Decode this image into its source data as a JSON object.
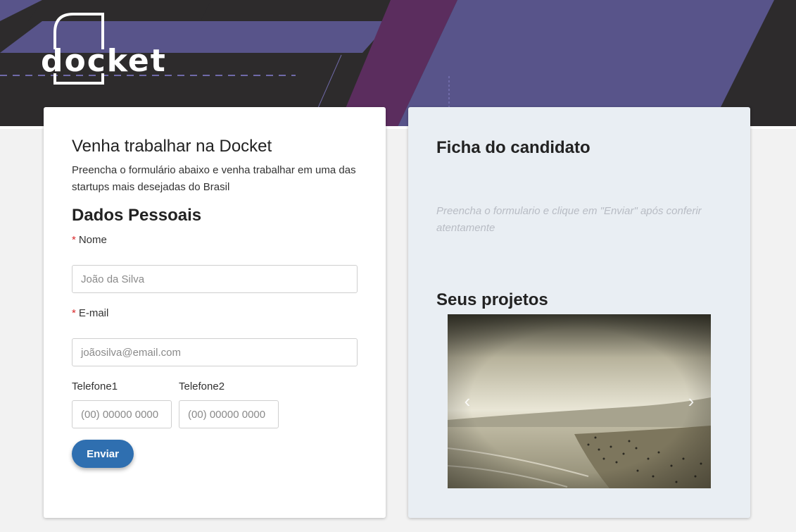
{
  "brand": {
    "logo_text": "docket"
  },
  "form": {
    "title": "Venha trabalhar na Docket",
    "subtitle": "Preencha o formulário abaixo e venha trabalhar em uma das startups mais desejadas do Brasil",
    "section_title": "Dados Pessoais",
    "required_mark": "*",
    "name_label": "Nome",
    "name_placeholder": "João da Silva",
    "email_label": "E-mail",
    "email_placeholder": "joãosilva@email.com",
    "phone1_label": "Telefone1",
    "phone1_placeholder": "(00) 00000 0000",
    "phone2_label": "Telefone2",
    "phone2_placeholder": "(00) 00000 0000",
    "submit_label": "Enviar"
  },
  "summary": {
    "title": "Ficha do candidato",
    "hint": "Preencha o formulario e clique em \"Enviar\" após conferir atentamente",
    "projects_title": "Seus projetos",
    "prev_icon": "chevron-left-icon",
    "next_icon": "chevron-right-icon"
  },
  "colors": {
    "banner_bg": "#2d2b2c",
    "banner_purple": "#58548a",
    "banner_magenta": "#5b2d5e",
    "accent": "#2f6fb0",
    "required": "#d9292b"
  }
}
